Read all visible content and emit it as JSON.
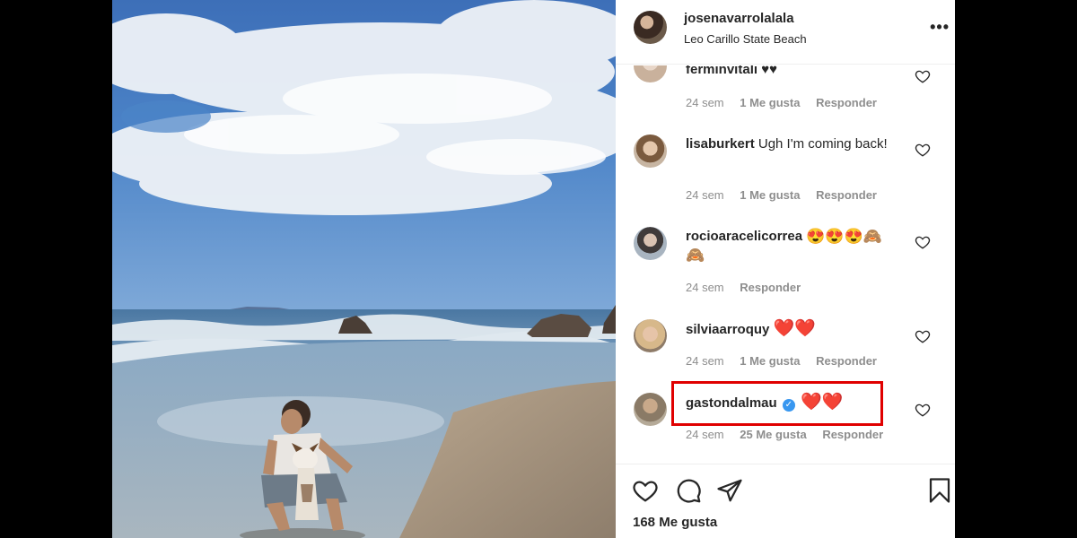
{
  "post": {
    "username": "josenavarrolalala",
    "location": "Leo Carillo State Beach",
    "more_icon": "more-options-icon",
    "likes_text": "168 Me gusta"
  },
  "comments": [
    {
      "username": "ferminvitali",
      "text": "♥♥",
      "time": "24 sem",
      "likes": "1 Me gusta",
      "reply": "Responder"
    },
    {
      "username": "lisaburkert",
      "text": "Ugh I'm coming back!",
      "time": "24 sem",
      "likes": "1 Me gusta",
      "reply": "Responder"
    },
    {
      "username": "rocioaracelicorrea",
      "text": "😍😍😍🙈🙈",
      "time": "24 sem",
      "likes": "",
      "reply": "Responder"
    },
    {
      "username": "silviaarroquy",
      "text": "❤️❤️",
      "time": "24 sem",
      "likes": "1 Me gusta",
      "reply": "Responder"
    },
    {
      "username": "gastondalmau",
      "text": "❤️❤️",
      "verified": true,
      "time": "24 sem",
      "likes": "25 Me gusta",
      "reply": "Responder",
      "highlighted": true
    }
  ],
  "icons": [
    "heart-icon",
    "comment-icon",
    "share-icon",
    "save-icon"
  ],
  "colors": {
    "highlight": "#e00000",
    "verified": "#3897f0",
    "meta_text": "#8e8e8e"
  }
}
